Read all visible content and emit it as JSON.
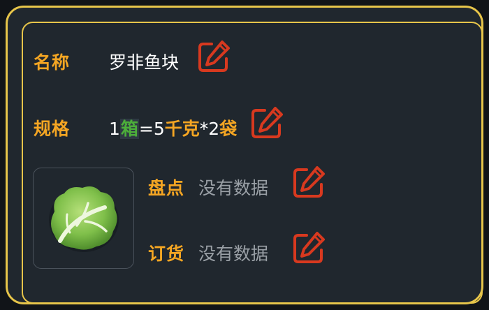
{
  "item": {
    "name_label": "名称",
    "name_value": "罗非鱼块",
    "spec_label": "规格",
    "spec": {
      "qty1": "1",
      "unit1": "箱",
      "eq": "=",
      "qty2": "5",
      "unit2": "千克",
      "times": "*",
      "qty3": "2",
      "unit3": "袋"
    },
    "inventory_label": "盘点",
    "inventory_value": "没有数据",
    "order_label": "订货",
    "order_value": "没有数据"
  },
  "icons": {
    "edit": "edit-icon",
    "product_image": "cabbage-icon"
  },
  "colors": {
    "background": "#20272e",
    "border": "#e7c54a",
    "label": "#f5a623",
    "edit_icon": "#d8391f",
    "muted": "#9aa0a6",
    "spec_unit_box": "#4cae3a"
  }
}
